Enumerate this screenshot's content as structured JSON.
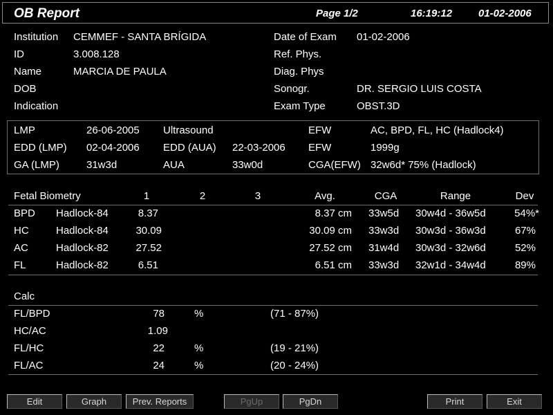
{
  "header": {
    "title": "OB Report",
    "page": "Page 1/2",
    "time": "16:19:12",
    "date": "01-02-2006"
  },
  "patient": {
    "institution_label": "Institution",
    "institution": "CEMMEF - SANTA BRÍGIDA",
    "id_label": "ID",
    "id": "3.008.128",
    "name_label": "Name",
    "name": "MARCIA DE PAULA",
    "dob_label": "DOB",
    "indication_label": "Indication",
    "exam_date_label": "Date of Exam",
    "exam_date": "01-02-2006",
    "ref_phys_label": "Ref. Phys.",
    "diag_phys_label": "Diag. Phys",
    "sonogr_label": "Sonogr.",
    "sonogr": "DR. SERGIO LUIS COSTA",
    "exam_type_label": "Exam Type",
    "exam_type": "OBST.3D"
  },
  "summary": {
    "lmp_label": "LMP",
    "lmp": "26-06-2005",
    "ultrasound_label": "Ultrasound",
    "efw_label": "EFW",
    "efw_method": "AC, BPD, FL, HC (Hadlock4)",
    "edd_lmp_label": "EDD (LMP)",
    "edd_lmp": "02-04-2006",
    "edd_aua_label": "EDD (AUA)",
    "edd_aua": "22-03-2006",
    "efw2_label": "EFW",
    "efw_value": "1999g",
    "ga_lmp_label": "GA (LMP)",
    "ga_lmp": "31w3d",
    "aua_label": "AUA",
    "aua": "33w0d",
    "cga_efw_label": "CGA(EFW)",
    "cga_efw": "32w6d* 75% (Hadlock)"
  },
  "biometry": {
    "headers": [
      "Fetal Biometry",
      "1",
      "2",
      "3",
      "Avg.",
      "CGA",
      "Range",
      "Dev"
    ],
    "rows": [
      {
        "name": "BPD",
        "method": "Hadlock-84",
        "m1": "8.37",
        "avg": "8.37 cm",
        "cga": "33w5d",
        "range": "30w4d - 36w5d",
        "dev": "54%*"
      },
      {
        "name": "HC",
        "method": "Hadlock-84",
        "m1": "30.09",
        "avg": "30.09 cm",
        "cga": "33w3d",
        "range": "30w3d - 36w3d",
        "dev": "67%"
      },
      {
        "name": "AC",
        "method": "Hadlock-82",
        "m1": "27.52",
        "avg": "27.52 cm",
        "cga": "31w4d",
        "range": "30w3d - 32w6d",
        "dev": "52%"
      },
      {
        "name": "FL",
        "method": "Hadlock-82",
        "m1": "6.51",
        "avg": "6.51 cm",
        "cga": "33w3d",
        "range": "32w1d - 34w4d",
        "dev": "89%"
      }
    ]
  },
  "calc": {
    "heading": "Calc",
    "rows": [
      {
        "name": "FL/BPD",
        "value": "78",
        "unit": "%",
        "range": "(71 - 87%)"
      },
      {
        "name": "HC/AC",
        "value": "1.09",
        "unit": "",
        "range": ""
      },
      {
        "name": "FL/HC",
        "value": "22",
        "unit": "%",
        "range": "(19 - 21%)"
      },
      {
        "name": "FL/AC",
        "value": "24",
        "unit": "%",
        "range": "(20 - 24%)"
      }
    ]
  },
  "buttons": {
    "edit": "Edit",
    "graph": "Graph",
    "prev_reports": "Prev. Reports",
    "pgup": "PgUp",
    "pgdn": "PgDn",
    "print": "Print",
    "exit": "Exit"
  }
}
